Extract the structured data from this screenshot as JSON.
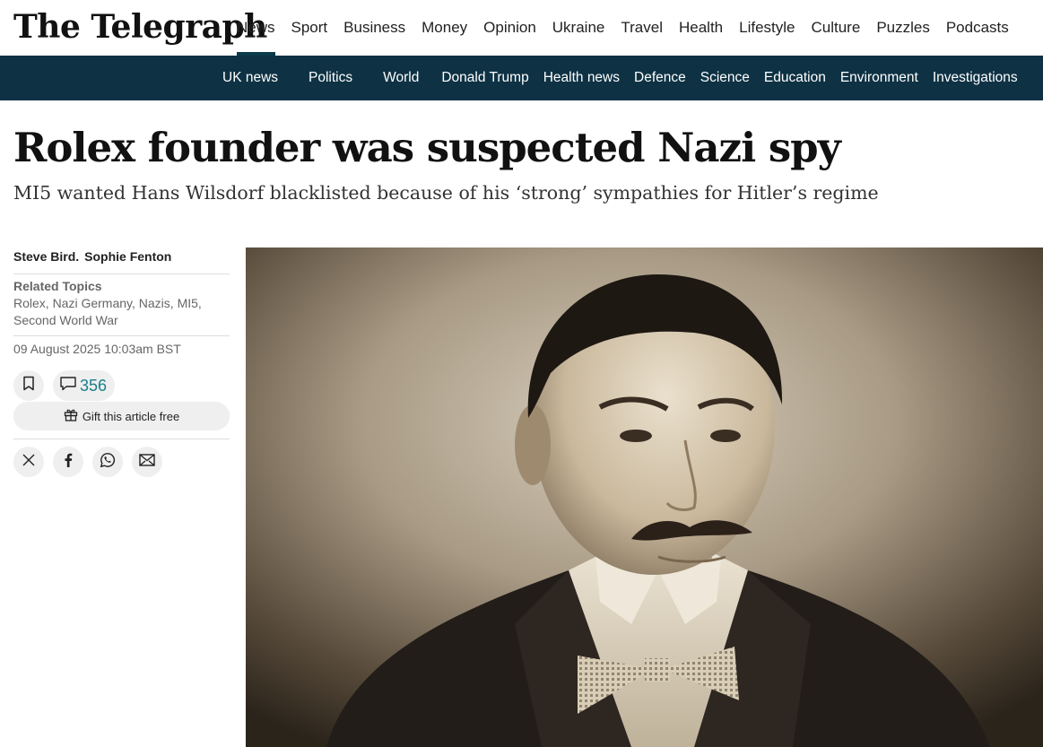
{
  "brand": {
    "logo": "The Telegraph"
  },
  "main_nav": [
    {
      "label": "News",
      "active": true
    },
    {
      "label": "Sport"
    },
    {
      "label": "Business"
    },
    {
      "label": "Money"
    },
    {
      "label": "Opinion"
    },
    {
      "label": "Ukraine"
    },
    {
      "label": "Travel"
    },
    {
      "label": "Health"
    },
    {
      "label": "Lifestyle"
    },
    {
      "label": "Culture"
    },
    {
      "label": "Puzzles"
    },
    {
      "label": "Podcasts"
    }
  ],
  "sub_nav": [
    {
      "label": "UK news"
    },
    {
      "label": "Politics"
    },
    {
      "label": "World"
    },
    {
      "label": "Donald Trump"
    },
    {
      "label": "Health news"
    },
    {
      "label": "Defence"
    },
    {
      "label": "Science"
    },
    {
      "label": "Education"
    },
    {
      "label": "Environment"
    },
    {
      "label": "Investigations"
    }
  ],
  "article": {
    "headline": "Rolex founder was suspected Nazi spy",
    "standfirst": "MI5 wanted Hans Wilsdorf blacklisted because of his ‘strong’ sympathies for Hitler’s regime",
    "authors": [
      "Steve Bird.",
      "Sophie Fenton"
    ],
    "related_topics_label": "Related Topics",
    "related_topics": "Rolex, Nazi Germany, Nazis, MI5, Second World War",
    "date": "09 August 2025 10:03am BST",
    "comment_count": "356",
    "gift_label": "Gift this article free"
  },
  "icons": {
    "bookmark": "bookmark-icon",
    "comment": "comment-icon",
    "gift": "gift-icon",
    "share": [
      "x-icon",
      "facebook-icon",
      "whatsapp-icon",
      "email-icon"
    ]
  },
  "colors": {
    "subnav_bg": "#0e3244",
    "accent": "#0b3a4a",
    "comment_count": "#1a7f8a"
  }
}
